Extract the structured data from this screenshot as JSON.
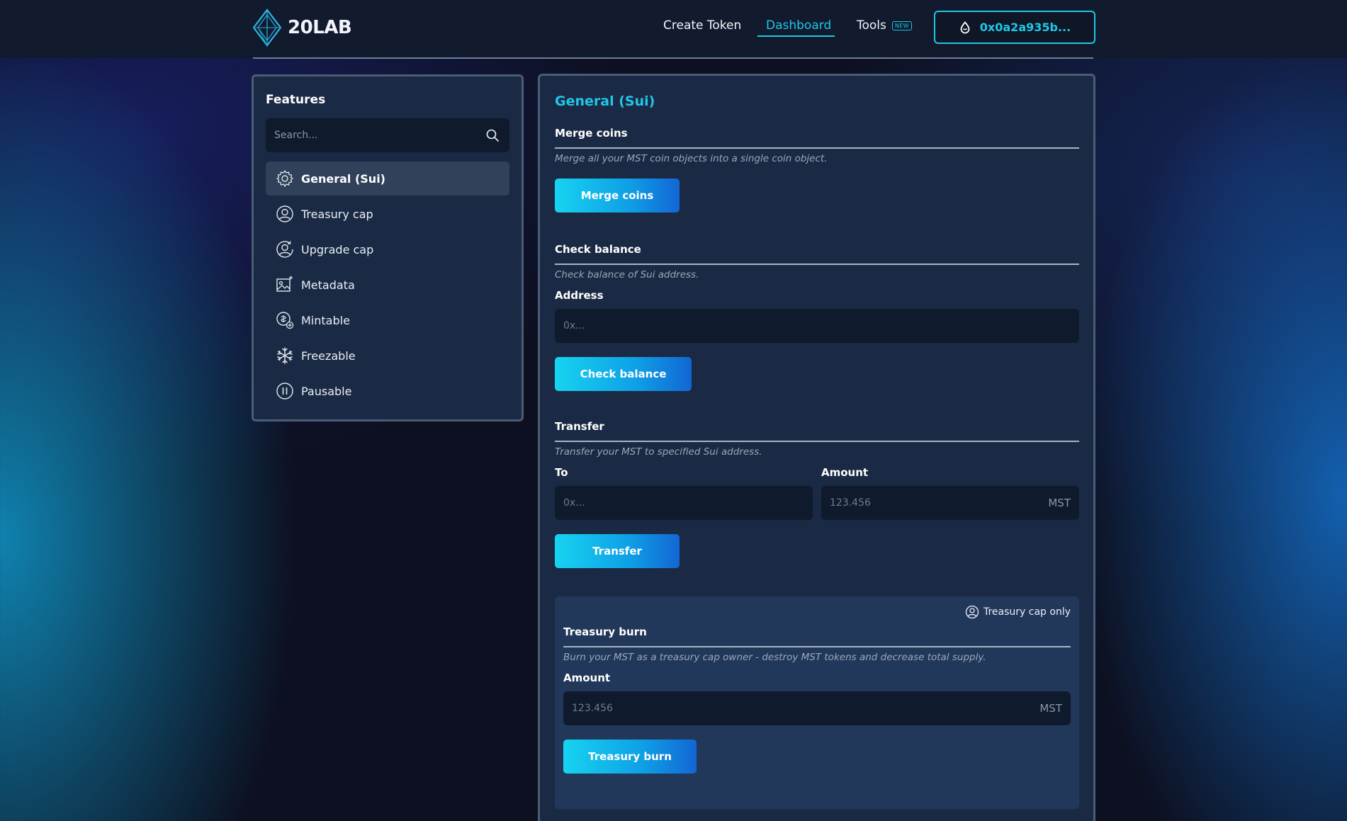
{
  "header": {
    "logo_text": "20LAB",
    "nav": {
      "create_token": "Create Token",
      "dashboard": "Dashboard",
      "tools": "Tools",
      "tools_badge": "NEW"
    },
    "wallet_address": "0x0a2a935b..."
  },
  "sidebar": {
    "title": "Features",
    "search_placeholder": "Search...",
    "items": [
      {
        "label": "General (Sui)",
        "icon": "gear-icon",
        "active": true
      },
      {
        "label": "Treasury cap",
        "icon": "user-circle-icon"
      },
      {
        "label": "Upgrade cap",
        "icon": "user-circle-refresh-icon"
      },
      {
        "label": "Metadata",
        "icon": "image-edit-icon"
      },
      {
        "label": "Mintable",
        "icon": "coin-plus-icon"
      },
      {
        "label": "Freezable",
        "icon": "snowflake-icon"
      },
      {
        "label": "Pausable",
        "icon": "pause-circle-icon"
      }
    ]
  },
  "main": {
    "title": "General (Sui)",
    "merge": {
      "title": "Merge coins",
      "description": "Merge all your MST coin objects into a single coin object.",
      "button": "Merge coins"
    },
    "check_balance": {
      "title": "Check balance",
      "description": "Check balance of Sui address.",
      "address_label": "Address",
      "address_placeholder": "0x...",
      "button": "Check balance"
    },
    "transfer": {
      "title": "Transfer",
      "description": "Transfer your MST to specified Sui address.",
      "to_label": "To",
      "to_placeholder": "0x...",
      "amount_label": "Amount",
      "amount_placeholder": "123.456",
      "amount_unit": "MST",
      "button": "Transfer"
    },
    "treasury_burn": {
      "badge": "Treasury cap only",
      "title": "Treasury burn",
      "description": "Burn your MST as a treasury cap owner - destroy MST tokens and decrease total supply.",
      "amount_label": "Amount",
      "amount_placeholder": "123.456",
      "amount_unit": "MST",
      "button": "Treasury burn"
    }
  },
  "colors": {
    "accent": "#1fc7e8",
    "panel": "#1b2a44",
    "input_bg": "#0f1b2d"
  }
}
